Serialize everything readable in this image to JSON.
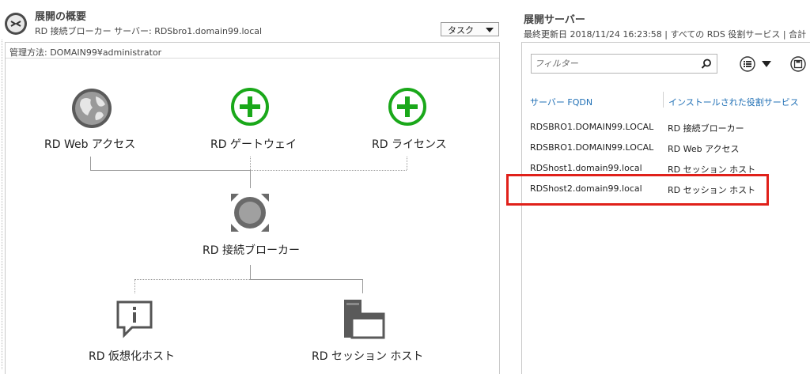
{
  "overview": {
    "title": "展開の概要",
    "subtitle": "RD 接続ブローカー サーバー: RDSbro1.domain99.local",
    "task_button": "タスク",
    "managed_by": "管理方法: DOMAIN99¥administrator",
    "nodes": {
      "web_access": "RD Web アクセス",
      "gateway": "RD ゲートウェイ",
      "licensing": "RD ライセンス",
      "connection_broker": "RD 接続ブローカー",
      "virtualization_host": "RD 仮想化ホスト",
      "session_host": "RD セッション ホスト"
    }
  },
  "servers": {
    "title": "展開サーバー",
    "subtitle": "最終更新日 2018/11/24 16:23:58 | すべての RDS 役割サービス | 合計",
    "filter_placeholder": "フィルター",
    "columns": [
      "サーバー FQDN",
      "インストールされた役割サービス"
    ],
    "rows": [
      {
        "fqdn": "RDSBRO1.DOMAIN99.LOCAL",
        "role": "RD 接続ブローカー"
      },
      {
        "fqdn": "RDSBRO1.DOMAIN99.LOCAL",
        "role": "RD Web アクセス"
      },
      {
        "fqdn": "RDShost1.domain99.local",
        "role": "RD セッション ホスト"
      },
      {
        "fqdn": "RDShost2.domain99.local",
        "role": "RD セッション ホスト"
      }
    ],
    "highlight_color": "#e0201a"
  },
  "colors": {
    "accent_green": "#1aa81a",
    "header_blue": "#1f6fb5"
  },
  "icons": [
    "deployment-icon",
    "globe-icon",
    "plus-circle-icon",
    "broker-icon",
    "info-callout-icon",
    "session-host-icon",
    "search-icon",
    "list-view-icon",
    "save-icon"
  ]
}
